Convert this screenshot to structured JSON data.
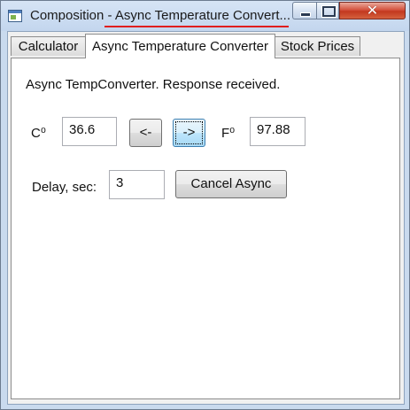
{
  "window": {
    "title": "Composition - Async Temperature Convert..."
  },
  "tabs": [
    {
      "label": "Calculator"
    },
    {
      "label": "Async Temperature Converter"
    },
    {
      "label": "Stock Prices"
    }
  ],
  "converter": {
    "status": "Async TempConverter. Response received.",
    "celsius_label": "C⁰",
    "celsius_value": "36.6",
    "to_celsius_label": "<-",
    "to_fahrenheit_label": "->",
    "fahrenheit_label": "F⁰",
    "fahrenheit_value": "97.88",
    "delay_label": "Delay, sec:",
    "delay_value": "3",
    "cancel_label": "Cancel Async"
  },
  "colors": {
    "title_underline": "#e01e1e",
    "close_button": "#c3381f",
    "focused_button": "#bee6fd"
  }
}
